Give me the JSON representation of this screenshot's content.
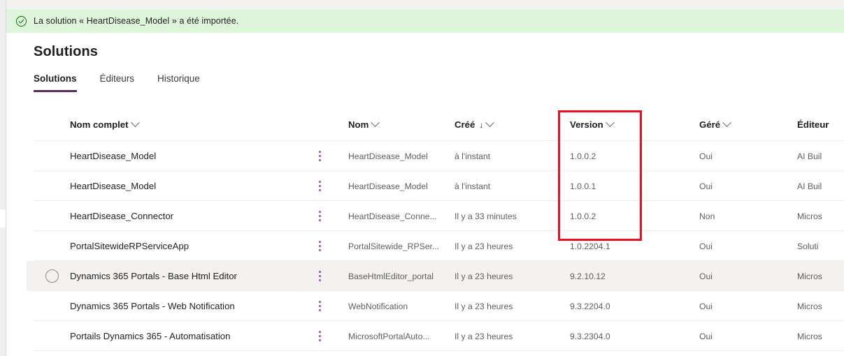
{
  "banner": {
    "icon": "check-circle-icon",
    "message": "La solution « HeartDisease_Model » a été importée.",
    "background_color": "#dff6dd",
    "icon_color": "#107c10"
  },
  "page": {
    "title": "Solutions"
  },
  "tabs": [
    {
      "label": "Solutions",
      "active": true
    },
    {
      "label": "Éditeurs",
      "active": false
    },
    {
      "label": "Historique",
      "active": false
    }
  ],
  "accent_color": "#5c2e5c",
  "annotation": {
    "type": "highlight-rectangle",
    "color": "#e81123",
    "targets": "Version column header and first three version values"
  },
  "table": {
    "columns": [
      {
        "key": "name",
        "label": "Nom complet",
        "sorted": false,
        "sort_arrow": ""
      },
      {
        "key": "uname",
        "label": "Nom",
        "sorted": false,
        "sort_arrow": ""
      },
      {
        "key": "created",
        "label": "Créé",
        "sorted": true,
        "sort_arrow": "↓"
      },
      {
        "key": "version",
        "label": "Version",
        "sorted": false,
        "sort_arrow": ""
      },
      {
        "key": "managed",
        "label": "Géré",
        "sorted": false,
        "sort_arrow": ""
      },
      {
        "key": "publisher",
        "label": "Éditeur",
        "sorted": false,
        "sort_arrow": ""
      }
    ],
    "rows": [
      {
        "name": "HeartDisease_Model",
        "uname": "HeartDisease_Model",
        "created": "à l'instant",
        "version": "1.0.0.2",
        "managed": "Oui",
        "publisher": "AI Buil",
        "hovered": false
      },
      {
        "name": "HeartDisease_Model",
        "uname": "HeartDisease_Model",
        "created": "à l'instant",
        "version": "1.0.0.1",
        "managed": "Oui",
        "publisher": "AI Buil",
        "hovered": false
      },
      {
        "name": "HeartDisease_Connector",
        "uname": "HeartDisease_Conne...",
        "created": "Il y a 33 minutes",
        "version": "1.0.0.2",
        "managed": "Non",
        "publisher": "Micros",
        "hovered": false
      },
      {
        "name": "PortalSitewideRPServiceApp",
        "uname": "PortalSitewide_RPSer...",
        "created": "Il y a 23 heures",
        "version": "1.0.2204.1",
        "managed": "Oui",
        "publisher": "Soluti",
        "hovered": false
      },
      {
        "name": "Dynamics 365 Portals - Base Html Editor",
        "uname": "BaseHtmlEditor_portal",
        "created": "Il y a 23 heures",
        "version": "9.2.10.12",
        "managed": "Oui",
        "publisher": "Micros",
        "hovered": true
      },
      {
        "name": "Dynamics 365 Portals - Web Notification",
        "uname": "WebNotification",
        "created": "Il y a 23 heures",
        "version": "9.3.2204.0",
        "managed": "Oui",
        "publisher": "Micros",
        "hovered": false
      },
      {
        "name": "Portails Dynamics 365 - Automatisation",
        "uname": "MicrosoftPortalAuto...",
        "created": "Il y a 23 heures",
        "version": "9.3.2304.0",
        "managed": "Oui",
        "publisher": "Micros",
        "hovered": false
      }
    ],
    "row_menu_icon": "more-options-vertical-icon",
    "row_select_icon": "radio-unselected-icon"
  }
}
